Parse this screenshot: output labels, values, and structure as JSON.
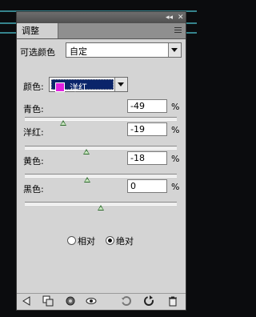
{
  "panel": {
    "tab_label": "调整",
    "titlebar": {
      "collapse": "◂◂",
      "close": "✕"
    }
  },
  "preset": {
    "label": "可选颜色",
    "value": "自定"
  },
  "colors": {
    "label": "颜色:",
    "value": "洋红",
    "swatch": "#e020e0"
  },
  "sliders": [
    {
      "label": "青色:",
      "value": "-49",
      "unit": "%",
      "level": -49
    },
    {
      "label": "洋红:",
      "value": "-19",
      "unit": "%",
      "level": -19
    },
    {
      "label": "黄色:",
      "value": "-18",
      "unit": "%",
      "level": -18
    },
    {
      "label": "黑色:",
      "value": "0",
      "unit": "%",
      "level": 0
    }
  ],
  "method": {
    "relative": "相对",
    "absolute": "绝对",
    "selected": "absolute"
  },
  "toolbar": [
    "back-icon",
    "clip-icon",
    "visibility-circle-icon",
    "eye-icon",
    "view-previous-icon",
    "reset-icon",
    "trash-icon"
  ]
}
